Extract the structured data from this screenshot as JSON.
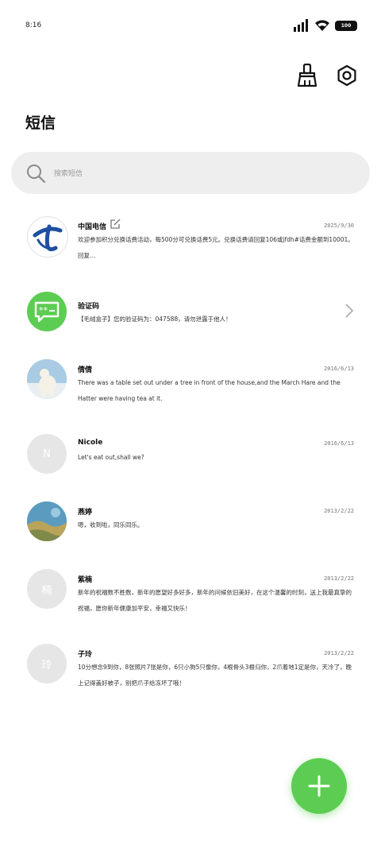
{
  "status_bar": {
    "time": "8:16",
    "battery": "100"
  },
  "header": {
    "title": "短信"
  },
  "search": {
    "placeholder": "搜索短信"
  },
  "conversations": [
    {
      "name": "中国电信",
      "date": "2025/9/30",
      "preview": "欢迎参加积分兑换话费活动，每500分可兑换话费5元。兑换话费请回复106或jfdh#话费金额到10001。回复…",
      "avatar": "china-telecom-logo"
    },
    {
      "name": "验证码",
      "date": "",
      "preview": "【毛绒盒子】您的验证码为：047588，请勿泄露于他人！",
      "avatar": "message-bubble"
    },
    {
      "name": "倩倩",
      "date": "2016/6/13",
      "preview": "There was a table set out under a tree in front of the house,and the March Hare and the Hatter were having tea at it.",
      "avatar": "polar-bear-photo"
    },
    {
      "name": "Nicole",
      "date": "2016/6/13",
      "preview": "Let's eat out,shall we?",
      "avatar_letter": "N"
    },
    {
      "name": "燕婷",
      "date": "2013/2/22",
      "preview": "嗯，收到啦，同乐同乐。",
      "avatar": "landscape-photo"
    },
    {
      "name": "紫楠",
      "date": "2013/2/22",
      "preview": "新年的祝福数不胜数，新年的愿望好多好多，新年的问候依旧美好，在这个温馨的时刻，送上我最真挚的祝福，愿你新年健康加平安，幸福又快乐！",
      "avatar_letter": "楠"
    },
    {
      "name": "子玲",
      "date": "2013/2/22",
      "preview": "10分想念9到你，8张照片7张是你，6只小狗5只像你，4根骨头3根归你，2爪着地1定是你，天冷了，晚上记得盖好被子，别把爪子给冻坏了哦！",
      "avatar_letter": "玲"
    }
  ],
  "colors": {
    "accent_green": "#5ccd52",
    "telecom_blue": "#1f4fa0"
  }
}
